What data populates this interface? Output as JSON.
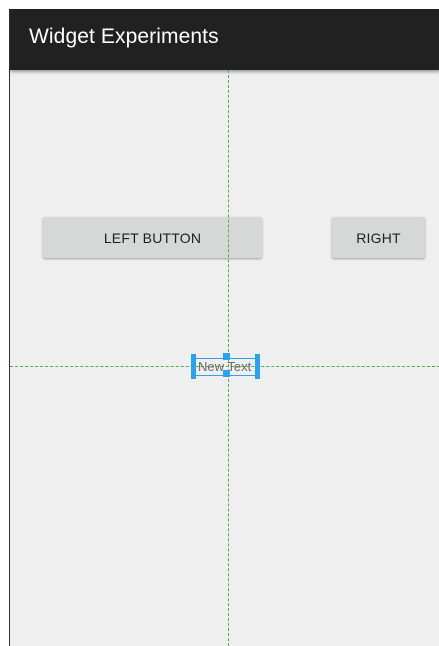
{
  "app_bar": {
    "title": "Widget Experiments"
  },
  "layout": {
    "left_button_label": "LEFT BUTTON",
    "right_button_label": "RIGHT",
    "text_view_label": "New Text"
  },
  "colors": {
    "app_bar": "#212121",
    "background": "#efefef",
    "button": "#d6d7d7",
    "guide_line": "#4caf50",
    "selection": "#29a3f0"
  }
}
